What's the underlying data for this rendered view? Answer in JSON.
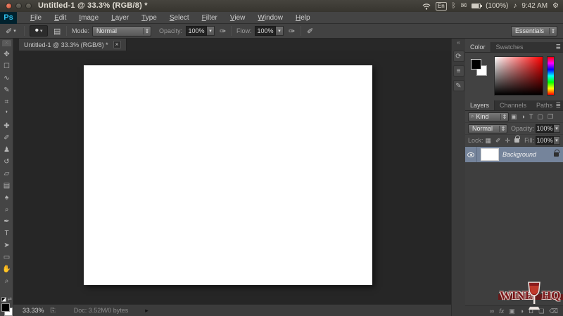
{
  "titlebar": {
    "title": "Untitled-1 @ 33.3% (RGB/8) *",
    "keyboard_indicator": "En",
    "bluetooth_glyph": "ᛒ",
    "mail_glyph": "✉",
    "battery_text": "(100%)",
    "speaker_glyph": "♪",
    "clock": "9:42 AM",
    "session_glyph": "⚙"
  },
  "menubar": {
    "logo_text": "Ps",
    "items": [
      "File",
      "Edit",
      "Image",
      "Layer",
      "Type",
      "Select",
      "Filter",
      "View",
      "Window",
      "Help"
    ]
  },
  "optionsbar": {
    "brush_tool_glyph": "✐",
    "brush_preset_glyph": "•",
    "panel_toggle_glyph": "▤",
    "mode_label": "Mode:",
    "mode_value": "Normal",
    "opacity_label": "Opacity:",
    "opacity_value": "100%",
    "pressure_opacity_glyph": "✑",
    "flow_label": "Flow:",
    "flow_value": "100%",
    "airbrush_glyph": "✑",
    "smoothing_glyph": "✐",
    "workspace_value": "Essentials"
  },
  "document_tab": {
    "title": "Untitled-1 @ 33.3% (RGB/8) *",
    "close_glyph": "×"
  },
  "toolbar": {
    "tools": [
      {
        "name": "move-tool",
        "glyph": "✥"
      },
      {
        "name": "marquee-tool",
        "glyph": "☐"
      },
      {
        "name": "lasso-tool",
        "glyph": "∿"
      },
      {
        "name": "quick-selection-tool",
        "glyph": "✎"
      },
      {
        "name": "crop-tool",
        "glyph": "⌗"
      },
      {
        "name": "eyedropper-tool",
        "glyph": "❜"
      },
      {
        "name": "healing-brush-tool",
        "glyph": "✚"
      },
      {
        "name": "brush-tool",
        "glyph": "✐"
      },
      {
        "name": "clone-stamp-tool",
        "glyph": "♟"
      },
      {
        "name": "history-brush-tool",
        "glyph": "↺"
      },
      {
        "name": "eraser-tool",
        "glyph": "▱"
      },
      {
        "name": "gradient-tool",
        "glyph": "▤"
      },
      {
        "name": "blur-tool",
        "glyph": "♠"
      },
      {
        "name": "dodge-tool",
        "glyph": "⌕"
      },
      {
        "name": "pen-tool",
        "glyph": "✒"
      },
      {
        "name": "type-tool",
        "glyph": "T"
      },
      {
        "name": "path-selection-tool",
        "glyph": "➤"
      },
      {
        "name": "shape-tool",
        "glyph": "▭"
      },
      {
        "name": "hand-tool",
        "glyph": "✋"
      },
      {
        "name": "zoom-tool",
        "glyph": "⌕"
      }
    ],
    "swap_colors_glyph": "⇄"
  },
  "statusbar": {
    "zoom_value": "33.33%",
    "save_icon_glyph": "⎘",
    "doc_info": "Doc: 3.52M/0 bytes",
    "popup_glyph": "▸"
  },
  "dock": {
    "collapse_glyph": "«",
    "icons": [
      {
        "name": "history-panel-icon",
        "glyph": "⟳"
      },
      {
        "name": "properties-panel-icon",
        "glyph": "≡"
      },
      {
        "name": "adjustments-panel-icon",
        "glyph": "✎"
      }
    ]
  },
  "color_panel": {
    "tabs": [
      "Color",
      "Swatches"
    ],
    "menu_glyph": "≣"
  },
  "layers_panel": {
    "tabs": [
      "Layers",
      "Channels",
      "Paths"
    ],
    "menu_glyph": "≣",
    "search_glyph": "⌕",
    "filter_kind_value": "Kind",
    "filter_icons": [
      "▣",
      "◑",
      "T",
      "▢",
      "❐"
    ],
    "blend_mode_value": "Normal",
    "opacity_label": "Opacity:",
    "opacity_value": "100%",
    "lock_label": "Lock:",
    "lock_icons": [
      "▦",
      "✐",
      "✛"
    ],
    "fill_label": "Fill:",
    "fill_value": "100%",
    "layers": [
      {
        "name": "Background",
        "visible": true,
        "locked": true
      }
    ],
    "bottom_icons": [
      {
        "name": "link-layers-icon",
        "glyph": "∞"
      },
      {
        "name": "layer-style-icon",
        "glyph": "fx"
      },
      {
        "name": "layer-mask-icon",
        "glyph": "▣"
      },
      {
        "name": "adjustment-layer-icon",
        "glyph": "◑"
      },
      {
        "name": "new-group-icon",
        "glyph": "⊔"
      },
      {
        "name": "new-layer-icon",
        "glyph": "❏"
      },
      {
        "name": "delete-layer-icon",
        "glyph": "⌫"
      }
    ]
  },
  "watermark": {
    "text_left": "WINE",
    "text_right": "HQ"
  },
  "colors": {
    "ps_logo_blue": "#2fc2ef",
    "layer_selection": "#75849b",
    "wine_red": "#7c1518",
    "canvas_white": "#ffffff"
  }
}
